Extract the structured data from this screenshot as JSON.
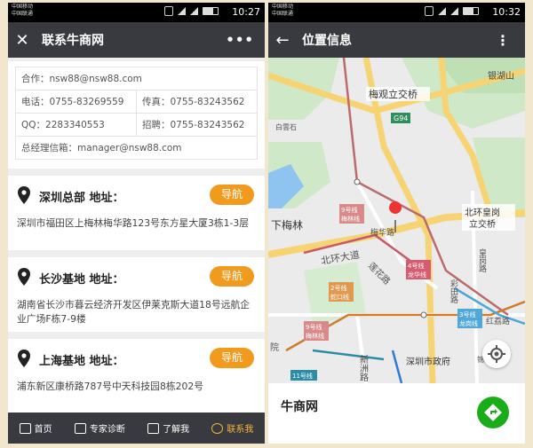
{
  "status_bar": {
    "carrier1": "中国移动",
    "carrier2": "中国联通",
    "time_left": "10:27",
    "time_right": "10:32"
  },
  "left": {
    "title": "联系牛商网",
    "contact": {
      "email": "合作：nsw88@nsw88.com",
      "phone": "电话：0755-83269559",
      "fax": "传真：0755-83243562",
      "qq": "QQ：2283340553",
      "hire": "招聘：0755-83243562",
      "manager": "总经理信箱：manager@nsw88.com"
    },
    "offices": [
      {
        "name": "深圳总部 地址：",
        "address": "深圳市福田区上梅林梅华路123号东方星大厦3栋1-3层",
        "nav": "导航"
      },
      {
        "name": "长沙基地 地址：",
        "address": "湖南省长沙市暮云经济开发区伊莱克斯大道18号远航企业广场F栋7-9楼",
        "nav": "导航"
      },
      {
        "name": "上海基地 地址：",
        "address": "浦东新区康桥路787号中天科技园8栋202号",
        "nav": "导航"
      }
    ],
    "bottom_nav": [
      {
        "label": "首页",
        "icon": "home-icon",
        "active": false
      },
      {
        "label": "专家诊断",
        "icon": "scan-icon",
        "active": false
      },
      {
        "label": "了解我",
        "icon": "document-icon",
        "active": false
      },
      {
        "label": "联系我",
        "icon": "phone-icon",
        "active": true
      }
    ],
    "accent": "#f09a1e"
  },
  "right": {
    "title": "位置信息",
    "place_name": "牛商网",
    "map_labels": {
      "bridge_top": "梅观立交桥",
      "bridge_right_1": "北环皇岗",
      "bridge_right_2": "立交桥",
      "xiameilin": "下梅林",
      "beihuan": "北环大道",
      "meihua": "梅华路",
      "lianhua": "莲花路",
      "caitian": "彩田路",
      "huanggang": "皇岗路",
      "xinzhou": "新洲路",
      "shizhengfu": "深圳市政府",
      "yinhushan": "银湖山",
      "baiyunshan": "白雲石",
      "jinxiu": "锦绣",
      "hongli": "红荔路",
      "yuan": "院",
      "g94": "G94",
      "l9a": "9号线",
      "l9a2": "梅林线",
      "l9b": "9号线",
      "l9b2": "梅林线",
      "l4a": "4号线",
      "l4a2": "龙华线",
      "l2": "2号线",
      "l2b": "蛇口线",
      "l3": "3号线",
      "l3b": "龙岗线",
      "l11": "11号线"
    },
    "green": "#1aad19"
  }
}
